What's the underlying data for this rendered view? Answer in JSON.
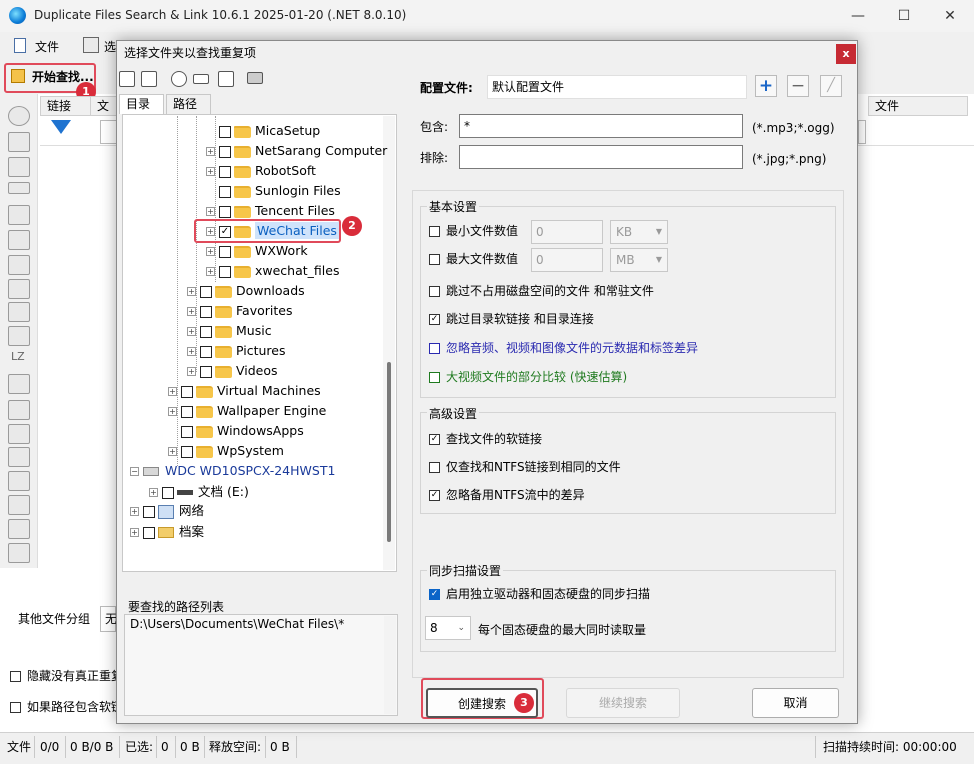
{
  "app": {
    "title": "Duplicate Files Search & Link 10.6.1 2025-01-20 (.NET 8.0.10)"
  },
  "menu": {
    "file": "文件",
    "partial": "选"
  },
  "toolbar": {
    "start_search": "开始查找..."
  },
  "main_columns": {
    "link": "链接",
    "file": "文件",
    "file_right": "文件"
  },
  "bottom": {
    "other_group_label": "其他文件分组",
    "other_group_value": "无",
    "hide_label": "隐藏没有真正重复",
    "path_contains_label": "如果路径包含软链"
  },
  "status": {
    "files_label": "文件",
    "files_value": "0/0",
    "size_value": "0 B/0 B",
    "selected_label": "已选:",
    "selected_count": "0",
    "selected_size": "0 B",
    "free_label": "释放空间:",
    "free_value": "0 B",
    "duration": "扫描持续时间: 00:00:00"
  },
  "badges": {
    "one": "1",
    "two": "2",
    "three": "3"
  },
  "dialog": {
    "title": "选择文件夹以查找重复项",
    "close": "x",
    "tabs": [
      "目录",
      "路径"
    ],
    "tree": [
      {
        "label": "MicaSetup",
        "checked": false,
        "expander": false
      },
      {
        "label": "NetSarang Computer",
        "checked": false,
        "expander": true
      },
      {
        "label": "RobotSoft",
        "checked": false,
        "expander": true
      },
      {
        "label": "Sunlogin Files",
        "checked": false,
        "expander": false
      },
      {
        "label": "Tencent Files",
        "checked": false,
        "expander": true
      },
      {
        "label": "WeChat Files",
        "checked": true,
        "expander": true,
        "selected": true
      },
      {
        "label": "WXWork",
        "checked": false,
        "expander": true
      },
      {
        "label": "xwechat_files",
        "checked": false,
        "expander": true
      },
      {
        "label": "Downloads",
        "checked": false,
        "expander": true
      },
      {
        "label": "Favorites",
        "checked": false,
        "expander": true
      },
      {
        "label": "Music",
        "checked": false,
        "expander": true
      },
      {
        "label": "Pictures",
        "checked": false,
        "expander": true
      },
      {
        "label": "Videos",
        "checked": false,
        "expander": true
      },
      {
        "label": "Virtual Machines",
        "checked": false,
        "expander": true
      },
      {
        "label": "Wallpaper Engine",
        "checked": false,
        "expander": true
      },
      {
        "label": "WindowsApps",
        "checked": false,
        "expander": false
      },
      {
        "label": "WpSystem",
        "checked": false,
        "expander": true
      },
      {
        "label": "WDC WD10SPCX-24HWST1",
        "checked": false,
        "expander": true
      },
      {
        "label": "文档 (E:)",
        "checked": false,
        "expander": true
      },
      {
        "label": "网络",
        "checked": false,
        "expander": true
      },
      {
        "label": "档案",
        "checked": false,
        "expander": true
      }
    ],
    "path_list_label": "要查找的路径列表",
    "path_list_item": "D:\\Users\\Documents\\WeChat Files\\*",
    "config_label": "配置文件:",
    "config_value": "默认配置文件",
    "include_label": "包含:",
    "include_value": "*",
    "include_hint": "(*.mp3;*.ogg)",
    "exclude_label": "排除:",
    "exclude_value": "",
    "exclude_hint": "(*.jpg;*.png)",
    "basic": {
      "title": "基本设置",
      "min_size_label": "最小文件数值",
      "min_size_value": "0",
      "min_unit": "KB",
      "max_size_label": "最大文件数值",
      "max_size_value": "0",
      "max_unit": "MB",
      "opt_skip_no_space": "跳过不占用磁盘空间的文件 和常驻文件",
      "opt_skip_dir_links": "跳过目录软链接 和目录连接",
      "opt_ignore_meta": "忽略音频、视频和图像文件的元数据和标签差异",
      "opt_partial_compare": "大视频文件的部分比较 (快速估算)"
    },
    "advanced": {
      "title": "高级设置",
      "opt_find_symlinks": "查找文件的软链接",
      "opt_only_ntfs": "仅查找和NTFS链接到相同的文件",
      "opt_ignore_ntfs_streams": "忽略备用NTFS流中的差异"
    },
    "sync": {
      "title": "同步扫描设置",
      "opt_enable": "启用独立驱动器和固态硬盘的同步扫描",
      "readers_value": "8",
      "readers_label": "每个固态硬盘的最大同时读取量"
    },
    "buttons": {
      "create": "创建搜索",
      "continue": "继续搜索",
      "cancel": "取消"
    }
  },
  "colors": {
    "accent": "#0a64c8",
    "badge": "#d92c3a",
    "blue_text": "#2a2ab0",
    "green_text": "#1f7a1f"
  }
}
